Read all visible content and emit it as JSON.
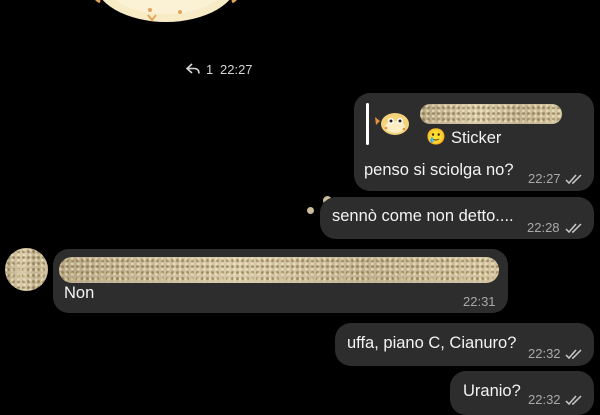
{
  "top_sticker": {
    "reply_count": "1",
    "time": "22:27"
  },
  "messages": [
    {
      "quote": {
        "label": "Sticker",
        "emoji": "🥲"
      },
      "text": "penso si sciolga no?",
      "time": "22:27"
    },
    {
      "text": "sennò come non detto....",
      "time": "22:28"
    },
    {
      "text": "Non",
      "time": "22:31"
    },
    {
      "text": "uffa, piano C, Cianuro?",
      "time": "22:32"
    },
    {
      "text": "Uranio?",
      "time": "22:32"
    }
  ],
  "colors": {
    "background": "#000000",
    "bubble": "#2d2d2d",
    "quote_bar": "#ffffff",
    "time": "#a9a9a9",
    "redaction": "#cbbd9c"
  },
  "icons": [
    "reply-icon",
    "double-check-icon",
    "pufferfish-sticker"
  ]
}
